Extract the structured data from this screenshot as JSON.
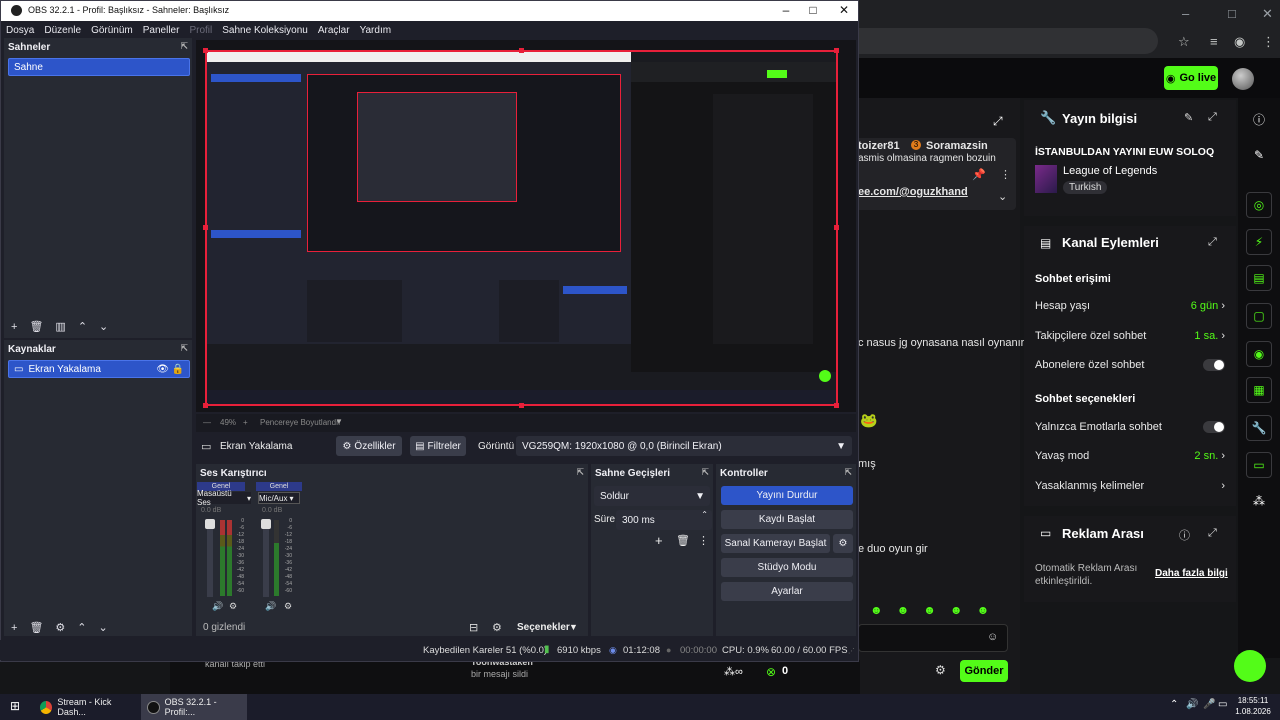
{
  "browser": {
    "controls": [
      "–",
      "□",
      "✕"
    ],
    "go_live": "Go live"
  },
  "chat": {
    "user1": "toizer81",
    "user2_badge": "3",
    "user2": "Soramazsin",
    "msg_frag1": "asmis olmasina ragmen bozuin",
    "link_frag": "ee.com/@oguzkhand",
    "msg_frag2": "c nasus jg oynasana nasıl oynanır",
    "msg_frag3": "mış",
    "msg_frag4": "e duo oyun gir",
    "send": "Gönder",
    "bottom_follow": "kanalı takip etti",
    "bottom_user": "Toonwastaken",
    "bottom_deleted": "bir mesajı sildi",
    "bottom_count": "0"
  },
  "stream_info": {
    "title": "Yayın bilgisi",
    "stream_title": "İSTANBULDAN YAYINI EUW SOLOQ",
    "game": "League of Legends",
    "tag": "Turkish"
  },
  "channel_actions": {
    "title": "Kanal Eylemleri",
    "chat_access": "Sohbet erişimi",
    "account_age": "Hesap yaşı",
    "account_age_value": "6 gün",
    "followers_chat": "Takipçilere özel sohbet",
    "followers_chat_value": "1 sa.",
    "subs_chat": "Abonelere özel sohbet",
    "chat_options": "Sohbet seçenekleri",
    "emote_only": "Yalnızca Emotlarla sohbet",
    "slow_mode": "Yavaş mod",
    "slow_mode_value": "2 sn.",
    "banned_words": "Yasaklanmış kelimeler"
  },
  "ad_break": {
    "title": "Reklam Arası",
    "desc": "Otomatik Reklam Arası etkinleştirildi.",
    "more": "Daha fazla bilgi"
  },
  "obs": {
    "window_title": "OBS 32.2.1 - Profil: Başlıksız - Sahneler: Başlıksız",
    "menu": [
      "Dosya",
      "Düzenle",
      "Görünüm",
      "Paneller",
      "Profil",
      "Sahne Koleksiyonu",
      "Araçlar",
      "Yardım"
    ],
    "scenes_title": "Sahneler",
    "scene_item": "Sahne",
    "sources_title": "Kaynaklar",
    "source_item": "Ekran Yakalama",
    "zoom": "49%",
    "fit_label": "Pencereye Boyutlandır",
    "selected_source": "Ekran Yakalama",
    "properties": "Özellikler",
    "filters": "Filtreler",
    "display_label": "Görüntü",
    "display_value": "VG259QM: 1920x1080 @ 0,0 (Birincil Ekran)",
    "mixer_title": "Ses Karıştırıcı",
    "mixer_ch1_group": "Genel",
    "mixer_ch1_name": "Masaüstü Ses",
    "mixer_ch2_group": "Genel",
    "mixer_ch2_name": "Mic/Aux",
    "db1": "0.0 dB",
    "db2": "0.0 dB",
    "meter_scale": [
      "0",
      "-6",
      "-12",
      "-18",
      "-24",
      "-30",
      "-36",
      "-42",
      "-48",
      "-54",
      "-60"
    ],
    "hidden_count": "0 gizlendi",
    "options": "Seçenekler",
    "transitions_title": "Sahne Geçişleri",
    "transition": "Soldur",
    "duration_label": "Süre",
    "duration_value": "300 ms",
    "controls_title": "Kontroller",
    "stop_stream": "Yayını Durdur",
    "start_record": "Kaydı Başlat",
    "virtual_cam": "Sanal Kamerayı Başlat",
    "studio_mode": "Stüdyo Modu",
    "settings": "Ayarlar",
    "status_dropped": "Kaybedilen Kareler 51 (%0.0)",
    "status_kbps": "6910 kbps",
    "status_stream_time": "01:12:08",
    "status_rec_time": "00:00:00",
    "status_cpu": "CPU: 0.9%",
    "status_fps": "60.00 / 60.00 FPS"
  },
  "taskbar": {
    "item1": "Stream - Kick Dash...",
    "item2": "OBS 32.2.1 - Profil:...",
    "time": "18:55:11",
    "date": "1.08.2026"
  },
  "colors": {
    "kick_green": "#53fc18",
    "obs_blue": "#2d55c9",
    "preview_border": "#e8203a"
  }
}
